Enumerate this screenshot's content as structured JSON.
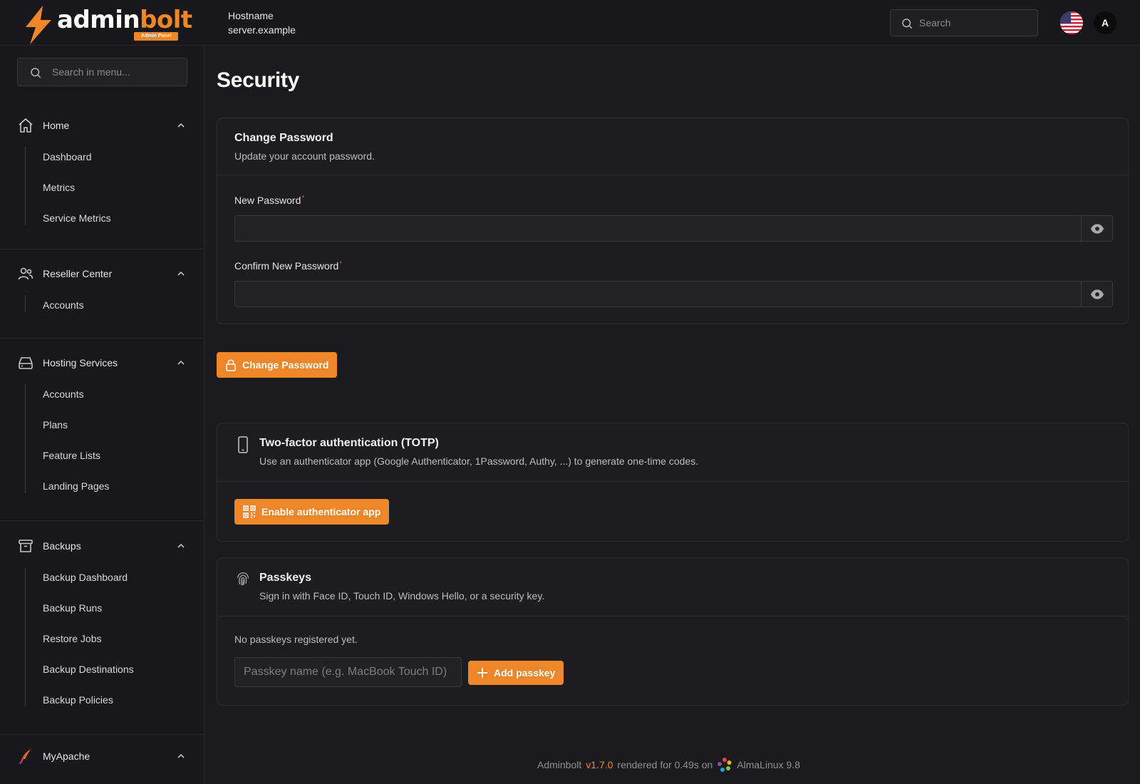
{
  "brand": {
    "name_main": "admin",
    "name_accent": "bolt",
    "badge": "Admin Panel",
    "accent_color": "#f0862a"
  },
  "header": {
    "hostname_label": "Hostname",
    "hostname_value": "server.example",
    "search_placeholder": "Search",
    "language_flag": "us-flag-icon",
    "avatar_initial": "A"
  },
  "sidebar": {
    "search_placeholder": "Search in menu...",
    "groups": [
      {
        "label": "Home",
        "icon": "home-icon",
        "expanded": true,
        "items": [
          "Dashboard",
          "Metrics",
          "Service Metrics"
        ]
      },
      {
        "label": "Reseller Center",
        "icon": "users-icon",
        "expanded": true,
        "items": [
          "Accounts"
        ]
      },
      {
        "label": "Hosting Services",
        "icon": "server-icon",
        "expanded": true,
        "items": [
          "Accounts",
          "Plans",
          "Feature Lists",
          "Landing Pages"
        ]
      },
      {
        "label": "Backups",
        "icon": "archive-icon",
        "expanded": true,
        "items": [
          "Backup Dashboard",
          "Backup Runs",
          "Restore Jobs",
          "Backup Destinations",
          "Backup Policies"
        ]
      },
      {
        "label": "MyApache",
        "icon": "apache-feather-icon",
        "expanded": true,
        "items": []
      }
    ]
  },
  "main": {
    "page_title": "Security",
    "change_password": {
      "title": "Change Password",
      "description": "Update your account password.",
      "new_password_label": "New Password",
      "new_password_value": "",
      "confirm_password_label": "Confirm New Password",
      "confirm_password_value": "",
      "required_mark": "*",
      "submit_label": "Change Password"
    },
    "totp": {
      "title": "Two-factor authentication (TOTP)",
      "description": "Use an authenticator app (Google Authenticator, 1Password, Authy, ...) to generate one-time codes.",
      "enable_label": "Enable authenticator app"
    },
    "passkeys": {
      "title": "Passkeys",
      "description": "Sign in with Face ID, Touch ID, Windows Hello, or a security key.",
      "empty_text": "No passkeys registered yet.",
      "name_placeholder": "Passkey name (e.g. MacBook Touch ID)",
      "name_value": "",
      "add_label": "Add passkey"
    }
  },
  "footer": {
    "product": "Adminbolt",
    "version": "v1.7.0",
    "render_text": "rendered for 0.49s on",
    "os": "AlmaLinux 9.8"
  }
}
